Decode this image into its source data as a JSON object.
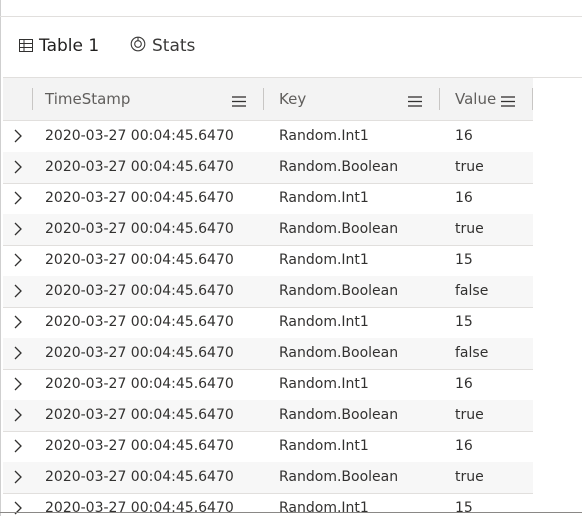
{
  "tabs": [
    {
      "label": "Table 1",
      "icon": "table-icon",
      "active": true
    },
    {
      "label": "Stats",
      "icon": "stats-icon",
      "active": false
    }
  ],
  "colors": {
    "accent": "#0f6cbd",
    "header_bg": "#f3f3f3",
    "row_alt_bg": "#f7f7f7"
  },
  "table": {
    "columns": [
      "TimeStamp",
      "Key",
      "Value"
    ],
    "rows": [
      [
        "2020-03-27 00:04:45.6470",
        "Random.Int1",
        "16"
      ],
      [
        "2020-03-27 00:04:45.6470",
        "Random.Boolean",
        "true"
      ],
      [
        "2020-03-27 00:04:45.6470",
        "Random.Int1",
        "16"
      ],
      [
        "2020-03-27 00:04:45.6470",
        "Random.Boolean",
        "true"
      ],
      [
        "2020-03-27 00:04:45.6470",
        "Random.Int1",
        "15"
      ],
      [
        "2020-03-27 00:04:45.6470",
        "Random.Boolean",
        "false"
      ],
      [
        "2020-03-27 00:04:45.6470",
        "Random.Int1",
        "15"
      ],
      [
        "2020-03-27 00:04:45.6470",
        "Random.Boolean",
        "false"
      ],
      [
        "2020-03-27 00:04:45.6470",
        "Random.Int1",
        "16"
      ],
      [
        "2020-03-27 00:04:45.6470",
        "Random.Boolean",
        "true"
      ],
      [
        "2020-03-27 00:04:45.6470",
        "Random.Int1",
        "16"
      ],
      [
        "2020-03-27 00:04:45.6470",
        "Random.Boolean",
        "true"
      ],
      [
        "2020-03-27 00:04:45.6470",
        "Random.Int1",
        "15"
      ]
    ]
  }
}
